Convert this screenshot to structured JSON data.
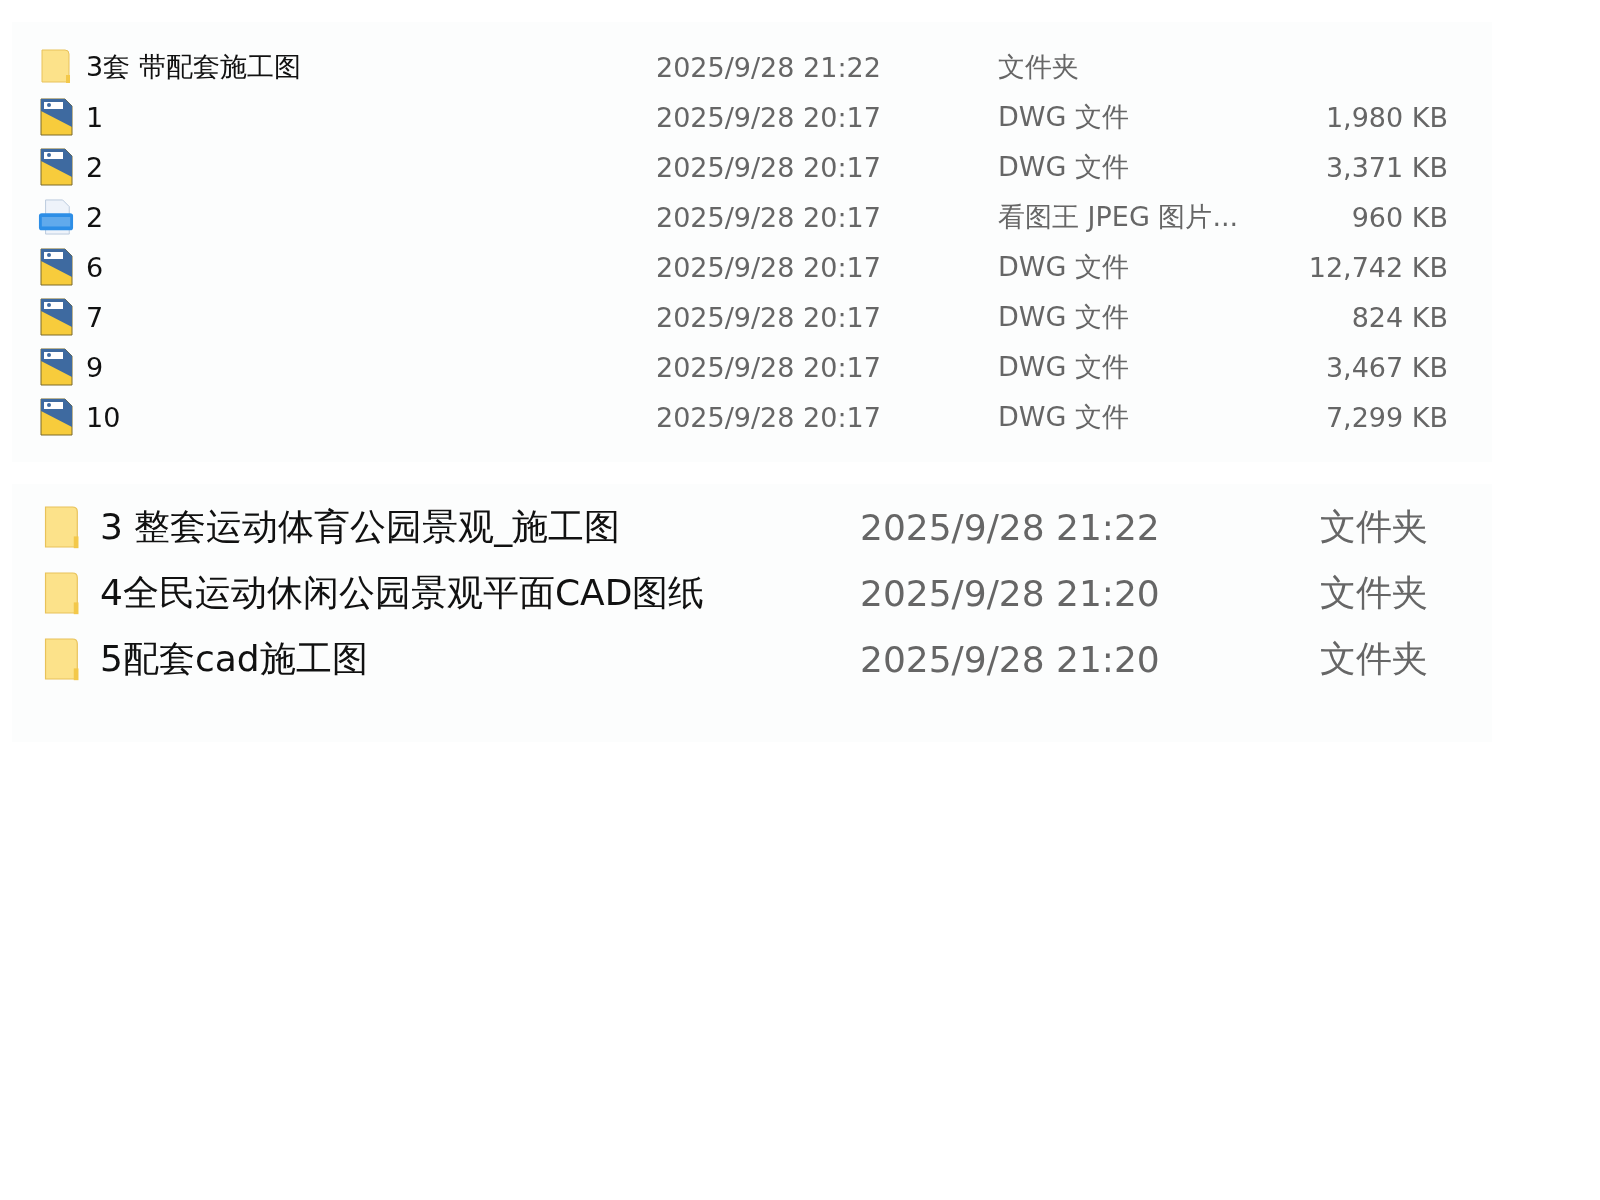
{
  "top_list": {
    "rows": [
      {
        "kind": "folder",
        "name": "3套 带配套施工图",
        "modified": "2025/9/28 21:22",
        "type": "文件夹"
      },
      {
        "kind": "dwg",
        "name": "1",
        "modified": "2025/9/28 20:17",
        "type": "DWG 文件",
        "size": "1,980 KB"
      },
      {
        "kind": "dwg",
        "name": "2",
        "modified": "2025/9/28 20:17",
        "type": "DWG 文件",
        "size": "3,371 KB"
      },
      {
        "kind": "jpg",
        "name": "2",
        "modified": "2025/9/28 20:17",
        "type": "看图王 JPEG 图片...",
        "size": "960 KB"
      },
      {
        "kind": "dwg",
        "name": "6",
        "modified": "2025/9/28 20:17",
        "type": "DWG 文件",
        "size": "12,742 KB"
      },
      {
        "kind": "dwg",
        "name": "7",
        "modified": "2025/9/28 20:17",
        "type": "DWG 文件",
        "size": "824 KB"
      },
      {
        "kind": "dwg",
        "name": "9",
        "modified": "2025/9/28 20:17",
        "type": "DWG 文件",
        "size": "3,467 KB"
      },
      {
        "kind": "dwg",
        "name": "10",
        "modified": "2025/9/28 20:17",
        "type": "DWG 文件",
        "size": "7,299 KB"
      }
    ]
  },
  "bottom_list": {
    "rows": [
      {
        "kind": "folder",
        "name": "3 整套运动体育公园景观_施工图",
        "modified": "2025/9/28 21:22",
        "type": "文件夹"
      },
      {
        "kind": "folder",
        "name": "4全民运动休闲公园景观平面CAD图纸",
        "modified": "2025/9/28 21:20",
        "type": "文件夹"
      },
      {
        "kind": "folder",
        "name": "5配套cad施工图",
        "modified": "2025/9/28 21:20",
        "type": "文件夹"
      }
    ]
  }
}
